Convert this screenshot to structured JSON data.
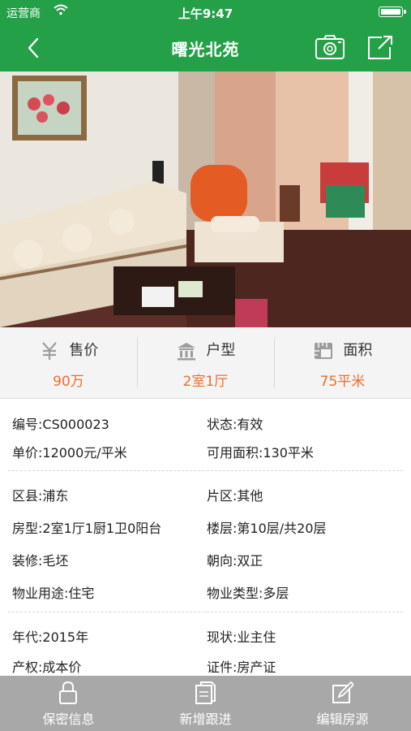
{
  "status_bar": {
    "carrier": "运营商",
    "time": "上午9:47"
  },
  "nav": {
    "title": "曙光北苑"
  },
  "summary": [
    {
      "label": "售价",
      "value": "90万",
      "icon": "yuan-icon"
    },
    {
      "label": "户型",
      "value": "2室1厅",
      "icon": "building-icon"
    },
    {
      "label": "面积",
      "value": "75平米",
      "icon": "area-icon"
    }
  ],
  "photo": {
    "dots": 4,
    "active": 0
  },
  "details": {
    "code": "编号:CS000023",
    "status": "状态:有效",
    "unit_price": "单价:12000元/平米",
    "usable_area": "可用面积:130平米",
    "district": "区县:浦东",
    "zone": "片区:其他",
    "layout": "房型:2室1厅1厨1卫0阳台",
    "floor": "楼层:第10层/共20层",
    "decoration": "装修:毛坯",
    "orientation": "朝向:双正",
    "usage": "物业用途:住宅",
    "property_type": "物业类型:多层",
    "year": "年代:2015年",
    "current": "现状:业主住",
    "ownership": "产权:成本价",
    "certificate": "证件:房产证"
  },
  "tabs": [
    {
      "label": "保密信息",
      "icon": "lock-icon"
    },
    {
      "label": "新增跟进",
      "icon": "document-icon"
    },
    {
      "label": "编辑房源",
      "icon": "edit-icon"
    }
  ],
  "colors": {
    "brand_green": "#24a148",
    "accent_orange": "#f06c2d",
    "tab_gray": "#a8a8a8"
  }
}
